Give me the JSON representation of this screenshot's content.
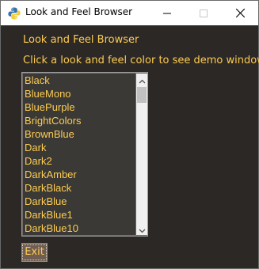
{
  "window": {
    "title": "Look and Feel Browser",
    "icon": "python-icon"
  },
  "titlebar_buttons": {
    "minimize": "minimize-icon",
    "maximize": "maximize-icon",
    "close": "close-icon"
  },
  "content": {
    "heading": "Look and Feel Browser",
    "instruction": "Click a look and feel color to see demo window"
  },
  "listbox": {
    "items": [
      "Black",
      "BlueMono",
      "BluePurple",
      "BrightColors",
      "BrownBlue",
      "Dark",
      "Dark2",
      "DarkAmber",
      "DarkBlack",
      "DarkBlue",
      "DarkBlue1",
      "DarkBlue10"
    ]
  },
  "exit_button": {
    "label": "Exit"
  },
  "colors": {
    "background": "#2c2825",
    "text": "#fdcb52",
    "list_background": "#3a3935",
    "button_background": "#705e52"
  }
}
